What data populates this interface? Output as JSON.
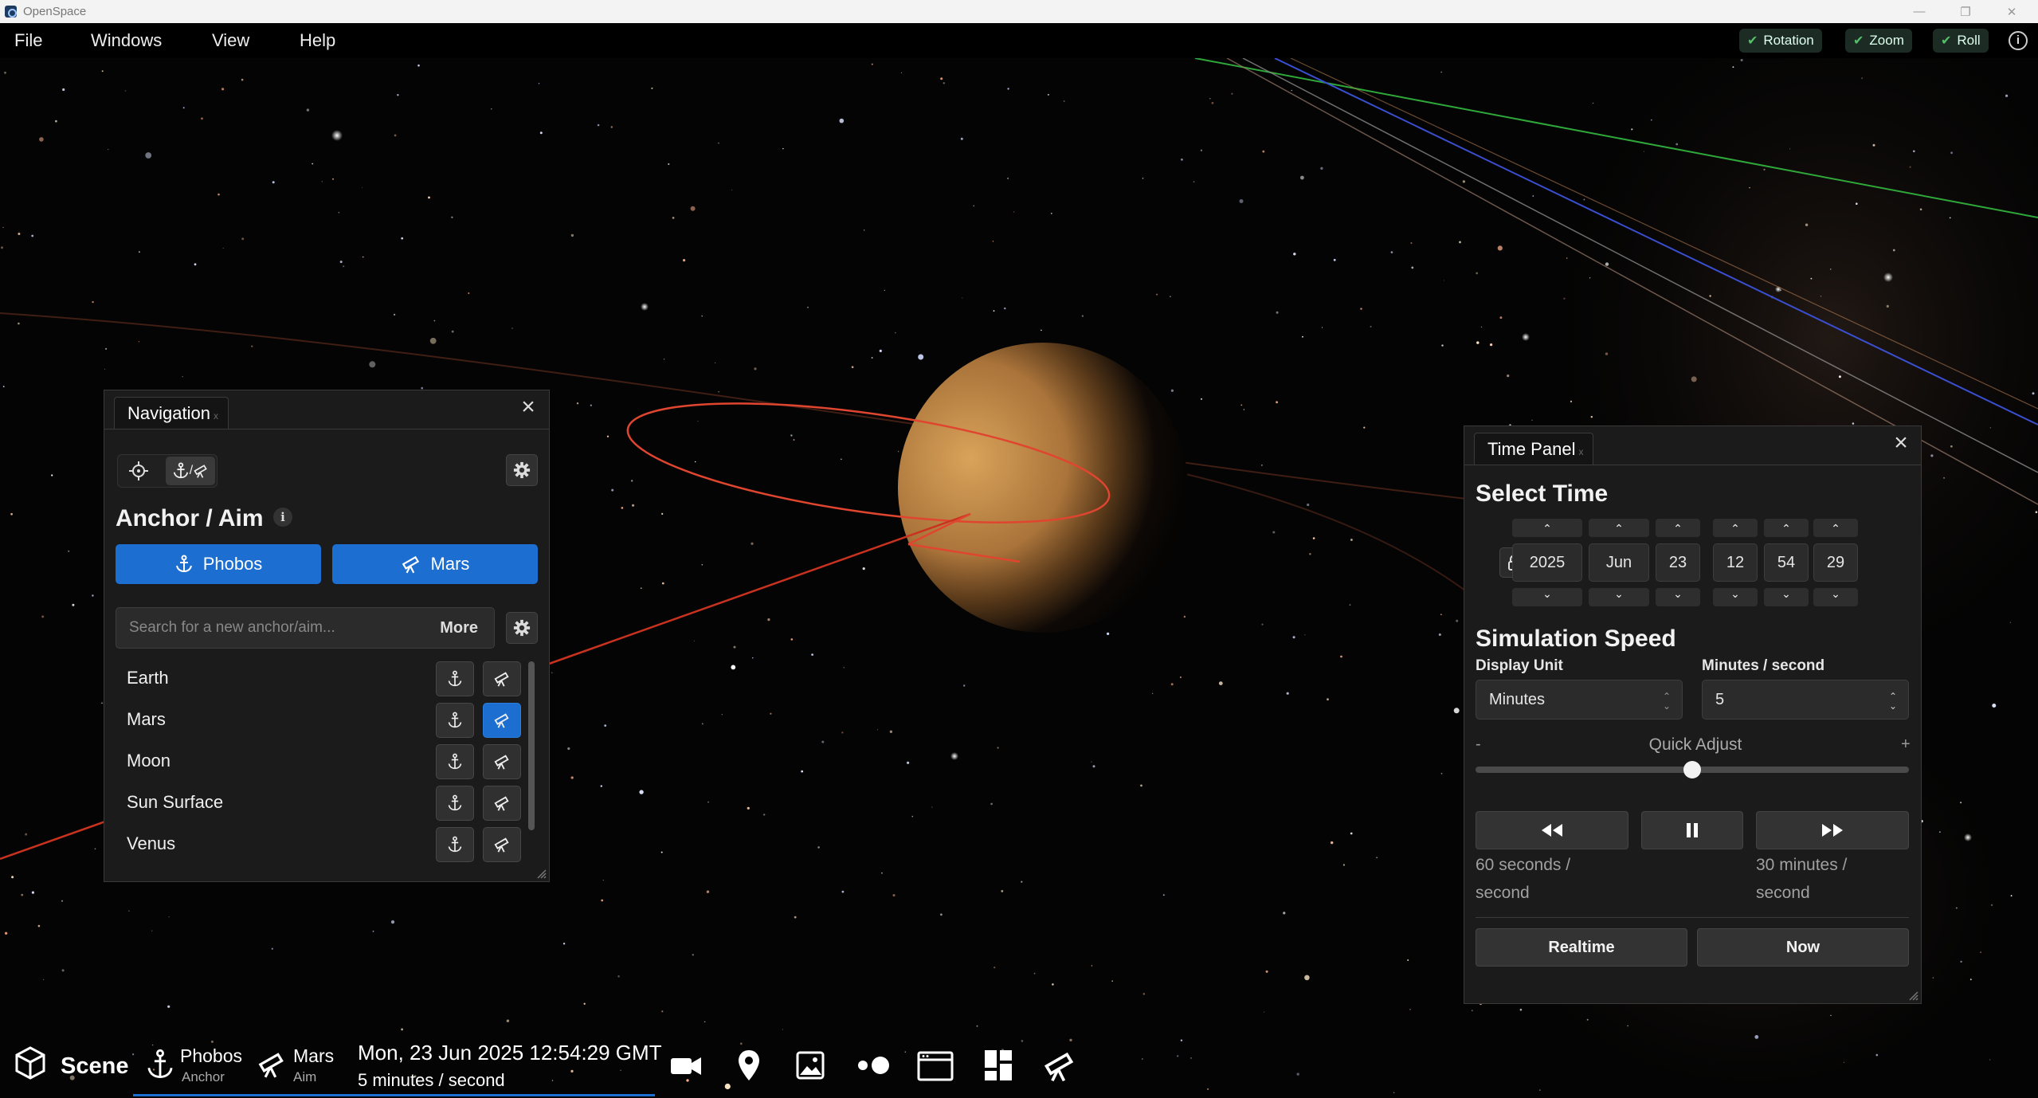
{
  "window": {
    "title": "OpenSpace",
    "controls": {
      "minimize": "—",
      "restore": "❐",
      "close": "✕"
    }
  },
  "menu": [
    "File",
    "Windows",
    "View",
    "Help"
  ],
  "camera_toggles": [
    {
      "label": "Rotation",
      "checked": true
    },
    {
      "label": "Zoom",
      "checked": true
    },
    {
      "label": "Roll",
      "checked": true
    }
  ],
  "navigation": {
    "tab_label": "Navigation",
    "tab_close": "x",
    "heading": "Anchor / Aim",
    "anchor_button": "Phobos",
    "aim_button": "Mars",
    "search_placeholder": "Search for a new anchor/aim...",
    "more_label": "More",
    "nodes": [
      {
        "name": "Earth",
        "aim_active": false
      },
      {
        "name": "Mars",
        "aim_active": true
      },
      {
        "name": "Moon",
        "aim_active": false
      },
      {
        "name": "Sun Surface",
        "aim_active": false
      },
      {
        "name": "Venus",
        "aim_active": false
      }
    ]
  },
  "time_panel": {
    "tab_label": "Time Panel",
    "tab_close": "x",
    "select_time_heading": "Select Time",
    "fields": {
      "year": "2025",
      "month": "Jun",
      "day": "23",
      "hour": "12",
      "minute": "54",
      "second": "29"
    },
    "simulation_speed_heading": "Simulation Speed",
    "display_unit_label": "Display Unit",
    "display_unit_value": "Minutes",
    "rate_label": "Minutes / second",
    "rate_value": "5",
    "quick_adjust_label": "Quick Adjust",
    "quick_adjust_minus": "-",
    "quick_adjust_plus": "+",
    "quick_adjust_position": 0.5,
    "slow_note": "60 seconds / second",
    "fast_note": "30 minutes / second",
    "realtime_label": "Realtime",
    "now_label": "Now"
  },
  "bottom_bar": {
    "scene_label": "Scene",
    "anchor_name": "Phobos",
    "anchor_caption": "Anchor",
    "aim_name": "Mars",
    "aim_caption": "Aim",
    "date_time": "Mon, 23 Jun 2025 12:54:29 GMT",
    "speed": "5 minutes / second",
    "icons": [
      "camera-icon",
      "location-pin-icon",
      "image-icon",
      "focus-dots-icon",
      "window-icon",
      "dashboard-icon",
      "telescope-icon"
    ]
  },
  "colors": {
    "accent_blue": "#1c6ed1",
    "check_green": "#55c06a",
    "panel_bg": "#1b1b1b",
    "orbit_red": "#e0452f",
    "mars_tan": "#c9914a"
  }
}
